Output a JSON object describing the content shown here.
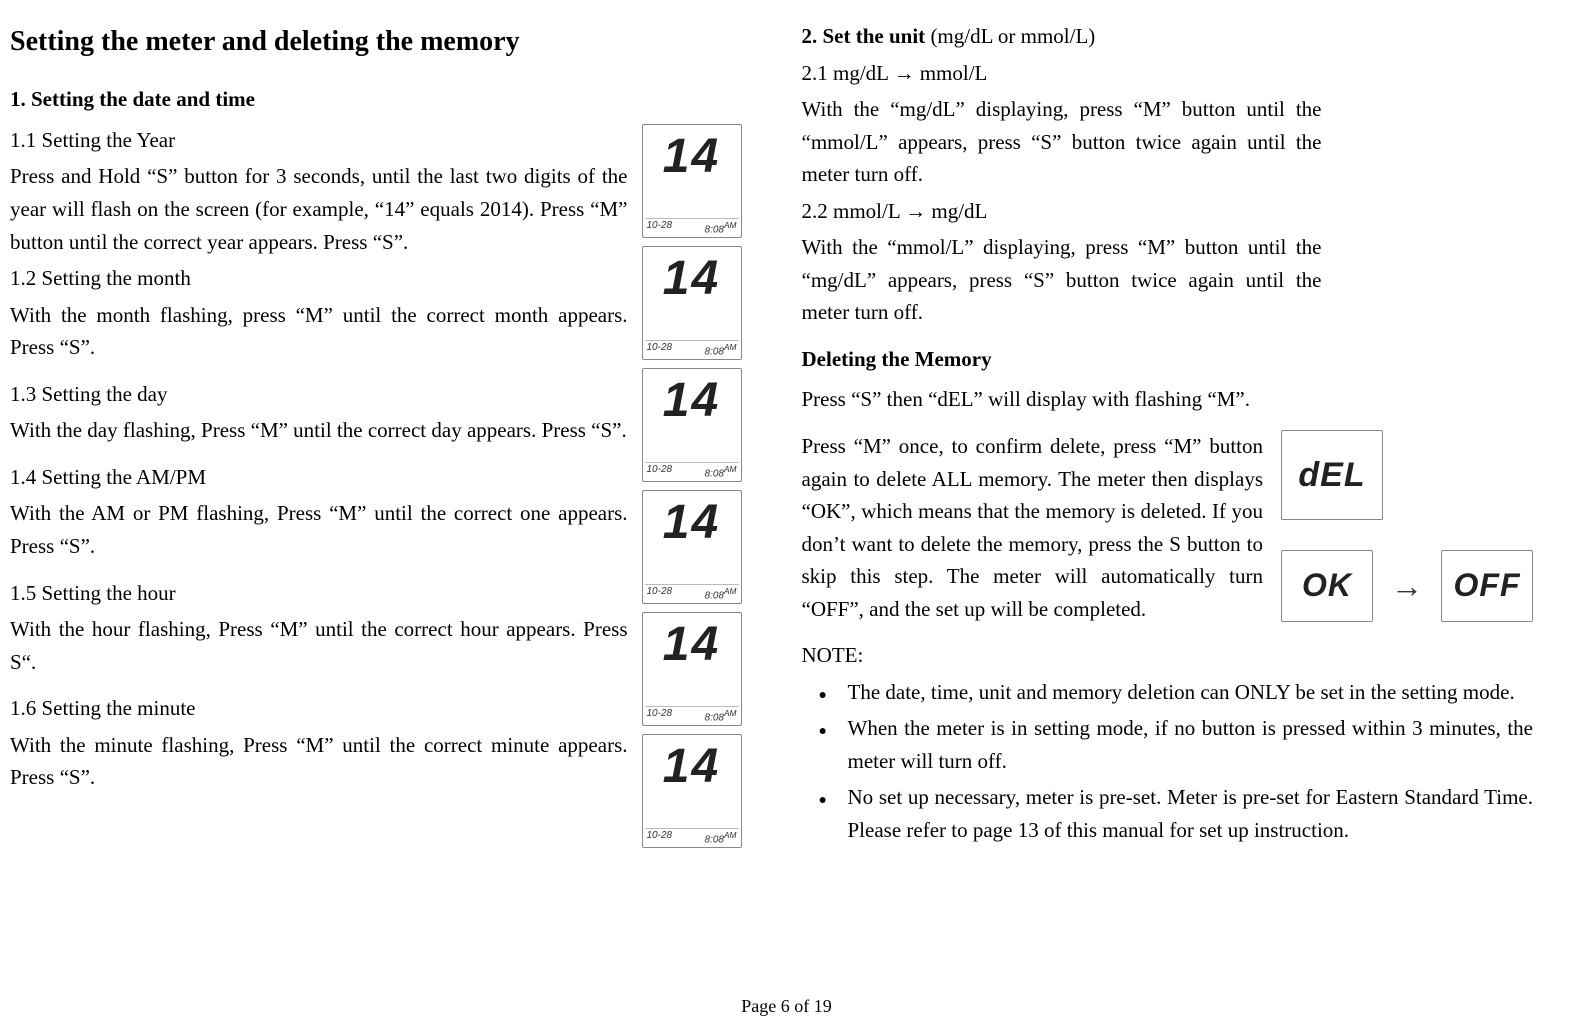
{
  "page": {
    "footer": "Page 6 of 19"
  },
  "left": {
    "title": "Setting the meter and deleting the memory",
    "h2": "1. Setting the date and time",
    "s11_h": "1.1 Setting the Year",
    "s11_p": "Press and Hold “S” button for 3 seconds, until the last two digits of the year will flash on the screen (for example, “14” equals 2014). Press “M” button until the correct year appears. Press “S”.",
    "s12_h": "1.2 Setting the month",
    "s12_p": "With the month flashing, press “M” until the correct month appears. Press “S”.",
    "s13_h": "1.3 Setting the day",
    "s13_p": "With the day flashing, Press “M” until the correct day appears. Press “S”.",
    "s14_h": "1.4 Setting the AM/PM",
    "s14_p": "With the AM or PM flashing, Press “M” until the correct one appears. Press “S”.",
    "s15_h": "1.5 Setting the hour",
    "s15_p": "With the hour flashing, Press “M” until the correct hour appears. Press S“.",
    "s16_h": "1.6 Setting the minute",
    "s16_p": "With the minute flashing, Press “M” until the correct minute appears. Press “S”."
  },
  "lcd": {
    "big": "14",
    "date": "10-28",
    "time": "8:08",
    "ampm": "AM"
  },
  "right": {
    "h2_bold": "2. Set the unit",
    "h2_rest": " (mg/dL or mmol/L)",
    "s21_h": "2.1 mg/dL → mmol/L",
    "s21_p": "With the “mg/dL” displaying, press “M” button until the “mmol/L” appears, press “S” button twice again until the meter turn off.",
    "s22_h": "2.2 mmol/L → mg/dL",
    "s22_p": "With the “mmol/L” displaying, press “M” button until the “mg/dL” appears, press “S” button twice again until the meter turn off.",
    "del_h": "Deleting the Memory",
    "del_p1": "Press “S” then “dEL” will display with flashing “M”.",
    "del_p2": "Press “M” once, to confirm delete, press “M” button again to delete ALL memory. The meter then displays “OK”, which means that the memory is deleted. If you don’t want to delete the memory, press the S button to skip this step. The meter will automatically turn “OFF”, and the set up will be completed.",
    "note_h": "NOTE:",
    "note1": "The date, time, unit and memory deletion can ONLY be set in the setting mode.",
    "note2": "When the meter is in setting mode, if no button is pressed within 3 minutes, the meter will turn off.",
    "note3": "No set up necessary, meter is pre-set. Meter is pre-set for Eastern Standard Time. Please refer to page 13 of this manual for set up instruction."
  },
  "disp": {
    "del": "dEL",
    "ok": "OK",
    "off": "OFF",
    "arrow": "→"
  }
}
